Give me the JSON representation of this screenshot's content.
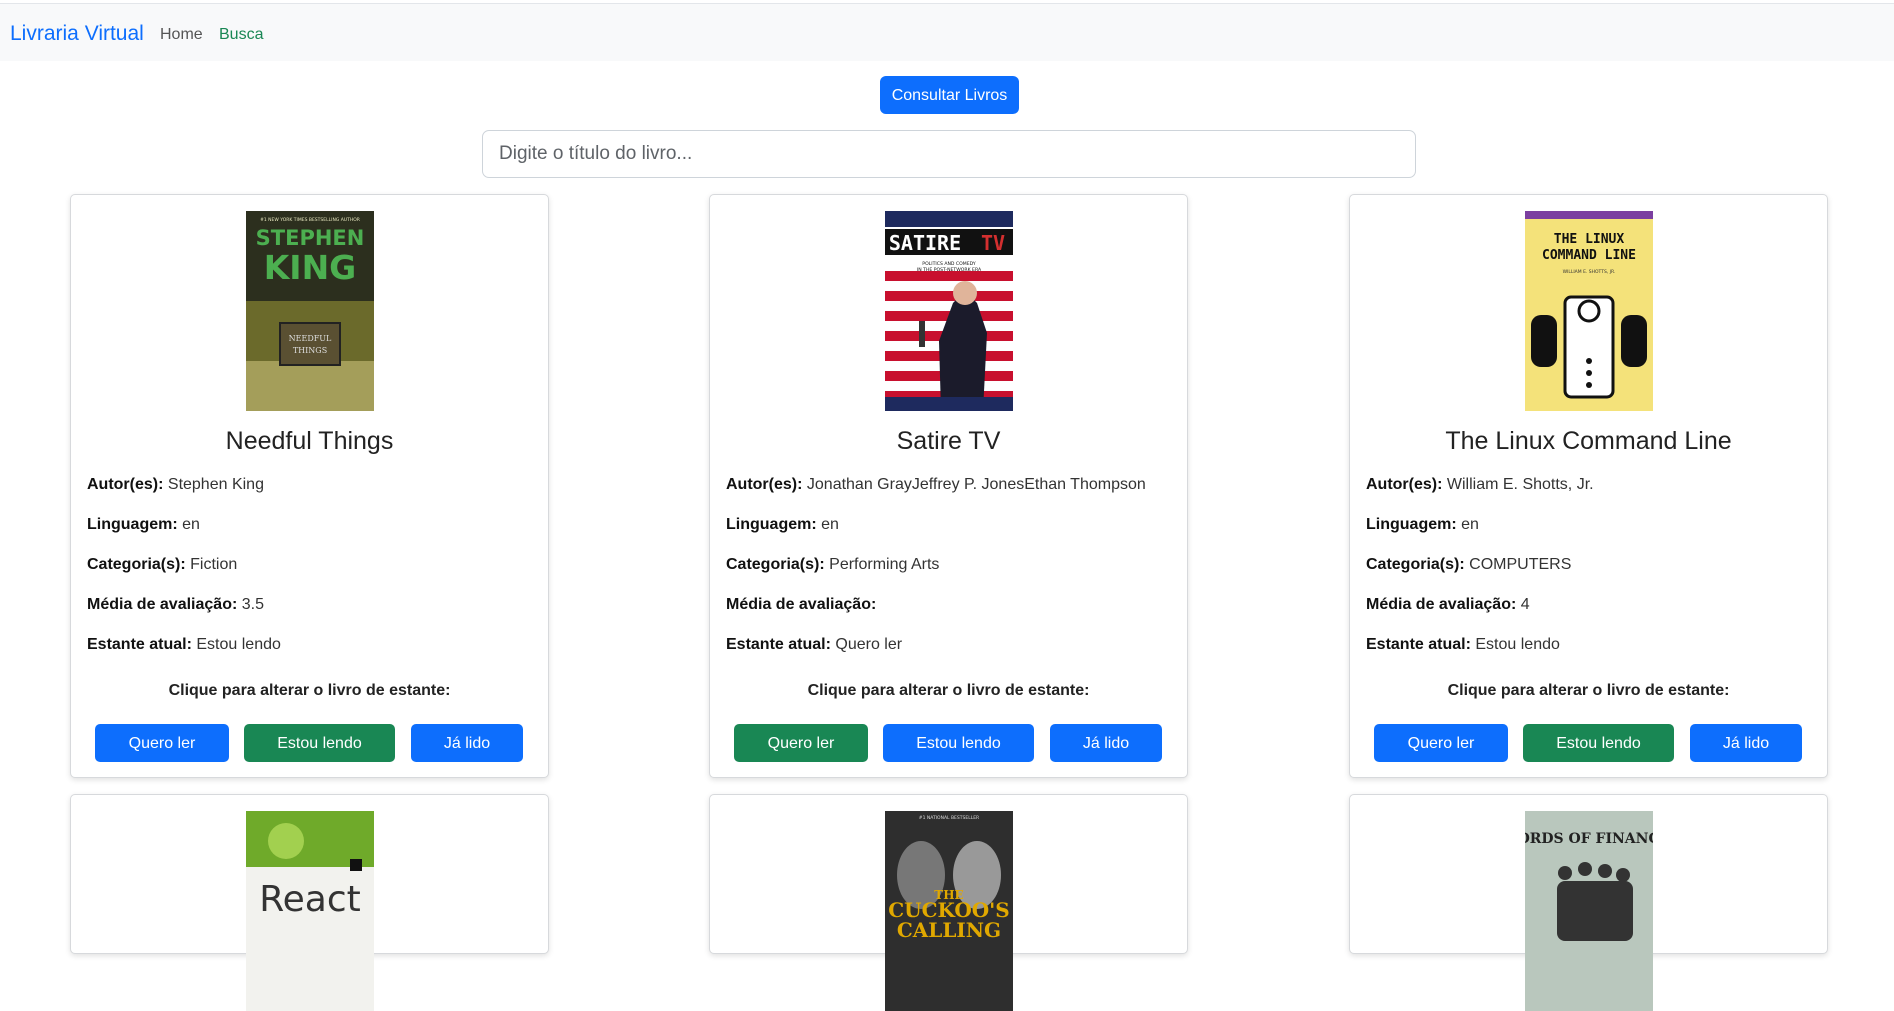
{
  "navbar": {
    "brand": "Livraria Virtual",
    "links": [
      "Home",
      "Busca"
    ]
  },
  "actions": {
    "consult_label": "Consultar Livros"
  },
  "search": {
    "placeholder": "Digite o título do livro..."
  },
  "labels": {
    "authors": "Autor(es):",
    "language": "Linguagem:",
    "categories": "Categoria(s):",
    "rating": "Média de avaliação:",
    "shelf": "Estante atual:",
    "prompt": "Clique para alterar o livro de estante:",
    "btn_want": "Quero ler",
    "btn_reading": "Estou lendo",
    "btn_read": "Já lido"
  },
  "colors": {
    "primary": "#0d6efd",
    "success": "#198754"
  },
  "books": [
    {
      "title": "Needful Things",
      "authors": "Stephen King",
      "language": "en",
      "categories": "Fiction",
      "rating": "3.5",
      "shelf": "Estou lendo",
      "cover_lines": [
        "#1 NEW YORK TIMES BESTSELLING AUTHOR",
        "STEPHEN",
        "KING",
        "NEEDFUL",
        "THINGS"
      ]
    },
    {
      "title": "Satire TV",
      "authors": "Jonathan GrayJeffrey P. JonesEthan Thompson",
      "language": "en",
      "categories": "Performing Arts",
      "rating": "",
      "shelf": "Quero ler",
      "cover_lines": [
        "SATIRE",
        "TV",
        "POLITICS AND COMEDY",
        "IN THE POST-NETWORK ERA"
      ]
    },
    {
      "title": "The Linux Command Line",
      "authors": "William E. Shotts, Jr.",
      "language": "en",
      "categories": "COMPUTERS",
      "rating": "4",
      "shelf": "Estou lendo",
      "cover_lines": [
        "THE LINUX",
        "COMMAND LINE",
        "WILLIAM E. SHOTTS, JR."
      ]
    },
    {
      "cover_lines": [
        "React"
      ]
    },
    {
      "cover_lines": [
        "#1 NATIONAL BESTSELLER",
        "THE",
        "CUCKOO'S",
        "CALLING"
      ]
    },
    {
      "cover_lines": [
        "LORDS OF FINANCE"
      ]
    }
  ]
}
